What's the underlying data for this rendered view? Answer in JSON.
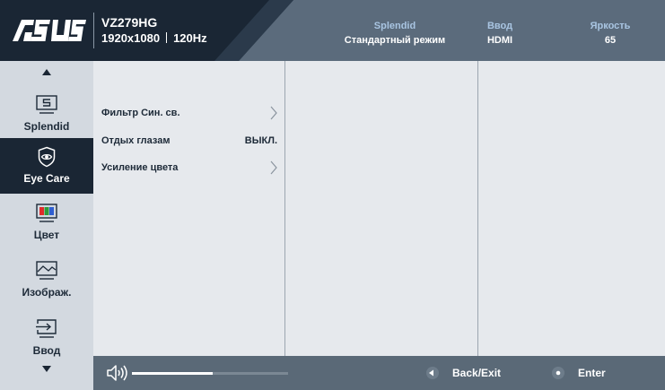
{
  "header": {
    "logo_text": "ASUS",
    "model": "VZ279HG",
    "resolution": "1920x1080",
    "refresh_rate": "120Hz",
    "stats": [
      {
        "label": "Splendid",
        "value": "Стандартный режим"
      },
      {
        "label": "Ввод",
        "value": "HDMI"
      },
      {
        "label": "Яркость",
        "value": "65"
      }
    ]
  },
  "sidebar": {
    "items": [
      {
        "label": "Splendid",
        "icon": "splendid-icon"
      },
      {
        "label": "Eye Care",
        "icon": "eye-care-icon",
        "active": true
      },
      {
        "label": "Цвет",
        "icon": "color-icon"
      },
      {
        "label": "Изображ.",
        "icon": "image-icon"
      },
      {
        "label": "Ввод",
        "icon": "input-icon"
      }
    ]
  },
  "menu": {
    "rows": [
      {
        "label": "Фильтр Син. св.",
        "value": "",
        "icon": "chevron-right-icon"
      },
      {
        "label": "Отдых глазам",
        "value": "ВЫКЛ."
      },
      {
        "label": "Усиление цвета",
        "value": "",
        "icon": "chevron-right-icon"
      }
    ]
  },
  "footer": {
    "volume_fraction": 0.52,
    "back_label": "Back/Exit",
    "enter_label": "Enter"
  },
  "colors": {
    "header_dark": "#1a2634",
    "header_light": "#5b6b7c",
    "accent_label": "#a9c5e2",
    "active_item": "#1a2634",
    "footer": "#5a6977"
  }
}
